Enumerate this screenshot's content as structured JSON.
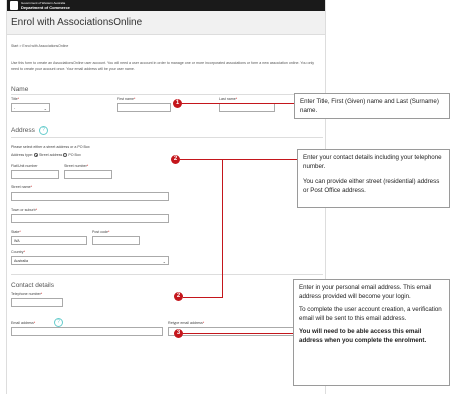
{
  "header": {
    "dept_line1": "Government of Western Australia",
    "dept_line2": "Department of Commerce",
    "title": "Enrol with AssociationsOnline"
  },
  "breadcrumb": "Start > Enrol with AssociationsOnline",
  "intro": "Use this form to create an AssociationsOnline user account. You will need a user account in order to manage one or more incorporated associations or form a new association online. You only need to create your account once. Your email address will be your user name.",
  "name_section": {
    "title": "Name",
    "title_label": "Title",
    "title_value": "-",
    "first_name_label": "First name",
    "last_name_label": "Last name"
  },
  "address_section": {
    "title": "Address",
    "help_icon": "?",
    "instruction": "Please select either a street address or a PO Box",
    "address_type_label": "Address type:",
    "option_street": "Street address",
    "option_pobox": "PO Box",
    "flat_label": "Flat/Unit number",
    "street_number_label": "Street number",
    "street_name_label": "Street name",
    "town_label": "Town or suburb",
    "state_label": "State",
    "state_value": "WA",
    "postcode_label": "Post code",
    "country_label": "Country",
    "country_value": "Australia"
  },
  "contact_section": {
    "title": "Contact details",
    "telephone_label": "Telephone number",
    "email_label": "Email address",
    "retype_email_label": "Retype email address",
    "help_icon": "?"
  },
  "required_mark": "*",
  "callouts": {
    "c1": "Enter Title, First (Given) name and Last (Surname) name.",
    "c2a": "Enter your contact details including your telephone number.",
    "c2b": "You can provide either street (residential) address or Post Office address.",
    "c3a": "Enter in your personal email address. This email address provided will become your login.",
    "c3b": "To complete the user account creation, a verification email will be sent to this email address.",
    "c3c": "You will need to be able access this email address when you complete the enrolment."
  },
  "markers": [
    "1",
    "2",
    "2",
    "3"
  ],
  "colors": {
    "marker": "#c4161c",
    "topbar": "#1a1a1a",
    "help": "#66cccc"
  }
}
